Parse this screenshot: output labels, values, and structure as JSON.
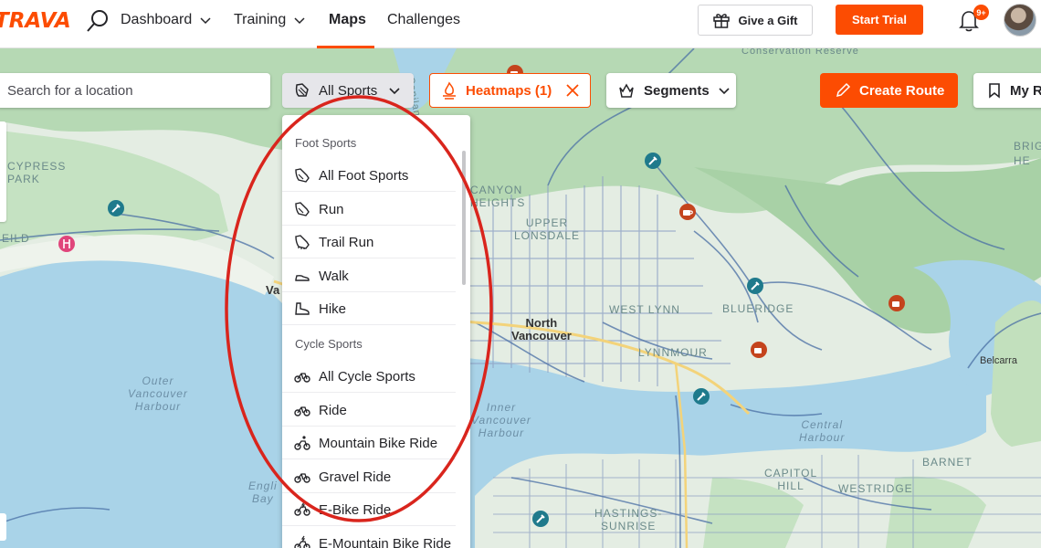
{
  "topnav": {
    "logo": "TRAVA",
    "items": [
      {
        "label": "Dashboard"
      },
      {
        "label": "Training"
      },
      {
        "label": "Maps"
      },
      {
        "label": "Challenges"
      }
    ],
    "gift_label": "Give a Gift",
    "trial_label": "Start Trial",
    "notification_count": "9+"
  },
  "map_toolbar": {
    "search_placeholder": "Search for a location",
    "sports_label": "All Sports",
    "heatmaps_label": "Heatmaps (1)",
    "segments_label": "Segments",
    "create_route_label": "Create Route",
    "my_routes_label": "My R"
  },
  "dropdown": {
    "groups": [
      {
        "title": "Foot Sports",
        "items": [
          {
            "label": "All Foot Sports",
            "icon": "shoe-icon"
          },
          {
            "label": "Run",
            "icon": "shoe-icon"
          },
          {
            "label": "Trail Run",
            "icon": "trail-shoe-icon"
          },
          {
            "label": "Walk",
            "icon": "walk-shoe-icon"
          },
          {
            "label": "Hike",
            "icon": "hike-boot-icon"
          }
        ]
      },
      {
        "title": "Cycle Sports",
        "items": [
          {
            "label": "All Cycle Sports",
            "icon": "bike-icon"
          },
          {
            "label": "Ride",
            "icon": "bike-icon"
          },
          {
            "label": "Mountain Bike Ride",
            "icon": "mountain-bike-icon"
          },
          {
            "label": "Gravel Ride",
            "icon": "bike-icon"
          },
          {
            "label": "E-Bike Ride",
            "icon": "e-bike-icon"
          },
          {
            "label": "E-Mountain Bike Ride",
            "icon": "e-mountain-bike-icon"
          }
        ]
      }
    ]
  },
  "map_labels": {
    "cypress_park": "CYPRESS\nPARK",
    "eild": "EILD",
    "canyon_heights": "CANYON\nHEIGHTS",
    "upper_lonsdale": "UPPER\nLONSDALE",
    "capilano": "Capilano",
    "north_vancouver": "North\nVancouver",
    "west_lynn": "WEST LYNN",
    "blueridge": "BLUERIDGE",
    "lynnmour": "LYNNMOUR",
    "outer_harbour": "Outer\nVancouver\nHarbour",
    "inner_harbour": "Inner\nVancouver\nHarbour",
    "central_harbour": "Central\nHarbour",
    "barnet": "BARNET",
    "capitol_hill": "CAPITOL\nHILL",
    "westridge": "WESTRIDGE",
    "hastings_sunrise": "HASTINGS-\nSUNRISE",
    "english_bay": "Engli\nBay",
    "belcarra": "Belcarra",
    "conservation_reserve": "Conservation Reserve",
    "brig": "BRIG",
    "he": "HE",
    "van": "Va"
  },
  "colors": {
    "brand": "#fc4c02",
    "water": "#a9d3e8",
    "land": "#e6efe6",
    "park": "#b7dcb5",
    "annotation": "#d9251d"
  }
}
